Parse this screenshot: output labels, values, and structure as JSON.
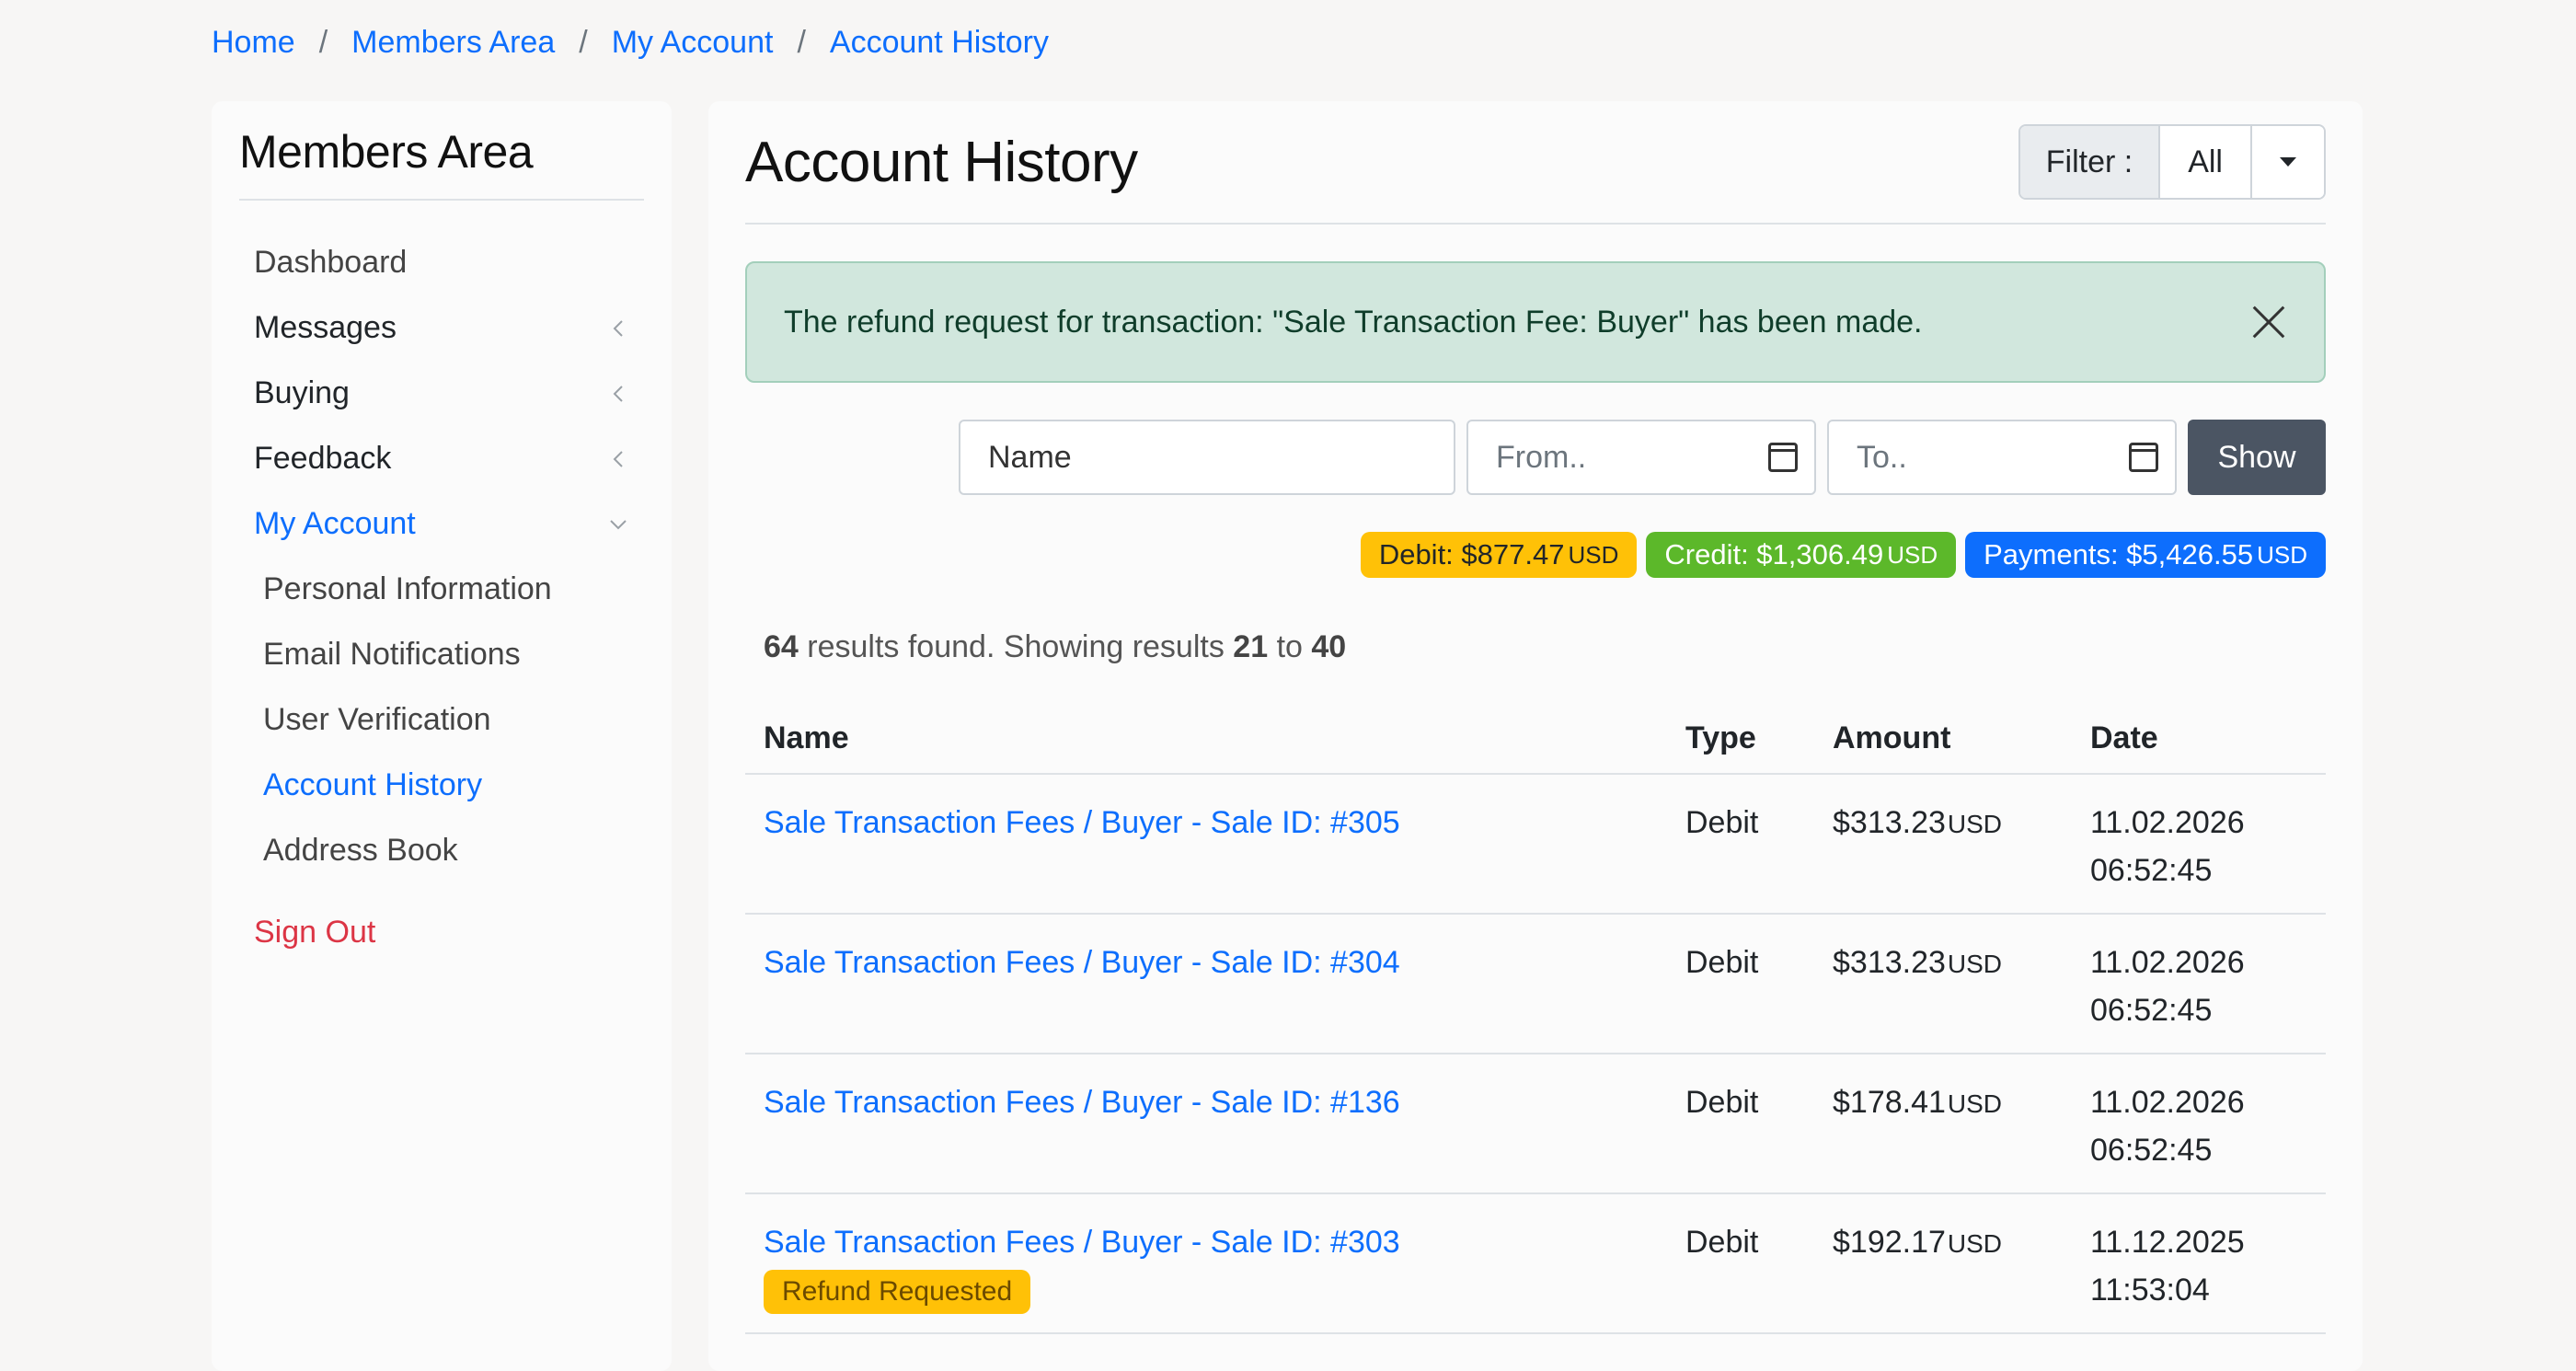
{
  "breadcrumb": {
    "items": [
      "Home",
      "Members Area",
      "My Account",
      "Account History"
    ],
    "separator": "/"
  },
  "sidebar": {
    "title": "Members Area",
    "items": [
      {
        "label": "Dashboard"
      },
      {
        "label": "Messages"
      },
      {
        "label": "Buying"
      },
      {
        "label": "Feedback"
      },
      {
        "label": "My Account"
      }
    ],
    "subitems": [
      {
        "label": "Personal Information"
      },
      {
        "label": "Email Notifications"
      },
      {
        "label": "User Verification"
      },
      {
        "label": "Account History"
      },
      {
        "label": "Address Book"
      }
    ],
    "signout": "Sign Out"
  },
  "main": {
    "title": "Account History",
    "filter": {
      "label": "Filter :",
      "value": "All"
    },
    "alert": "The refund request for transaction: \"Sale Transaction Fee: Buyer\" has been made.",
    "search": {
      "name_placeholder": "Name",
      "from_placeholder": "From..",
      "to_placeholder": "To..",
      "show_label": "Show"
    },
    "badges": {
      "debit": "Debit: $877.47",
      "credit": "Credit: $1,306.49",
      "payments": "Payments: $5,426.55",
      "currency": "USD"
    },
    "results": {
      "total": "64",
      "text1": " results found. Showing results ",
      "from": "21",
      "text2": " to ",
      "to": "40"
    },
    "table": {
      "headers": {
        "name": "Name",
        "type": "Type",
        "amount": "Amount",
        "date": "Date"
      },
      "rows": [
        {
          "name": "Sale Transaction Fees / Buyer - Sale ID: #305",
          "type": "Debit",
          "amount": "$313.23",
          "currency": "USD",
          "date": "11.02.2026",
          "time": "06:52:45",
          "badge": ""
        },
        {
          "name": "Sale Transaction Fees / Buyer - Sale ID: #304",
          "type": "Debit",
          "amount": "$313.23",
          "currency": "USD",
          "date": "11.02.2026",
          "time": "06:52:45",
          "badge": ""
        },
        {
          "name": "Sale Transaction Fees / Buyer - Sale ID: #136",
          "type": "Debit",
          "amount": "$178.41",
          "currency": "USD",
          "date": "11.02.2026",
          "time": "06:52:45",
          "badge": ""
        },
        {
          "name": "Sale Transaction Fees / Buyer - Sale ID: #303",
          "type": "Debit",
          "amount": "$192.17",
          "currency": "USD",
          "date": "11.12.2025",
          "time": "11:53:04",
          "badge": "Refund Requested"
        }
      ]
    }
  },
  "colors": {
    "link": "#0d6efd",
    "danger": "#dc3545",
    "success_bg": "#d1e7dd",
    "debit_badge": "#ffc107",
    "credit_badge": "#5cb82a",
    "payments_badge": "#0d6efd",
    "show_button": "#4b5563"
  },
  "icons": {
    "chevron_collapsed": "chevron-left-icon",
    "chevron_expanded": "chevron-down-icon",
    "close": "close-icon",
    "calendar": "calendar-icon",
    "dropdown": "caret-down-icon"
  }
}
